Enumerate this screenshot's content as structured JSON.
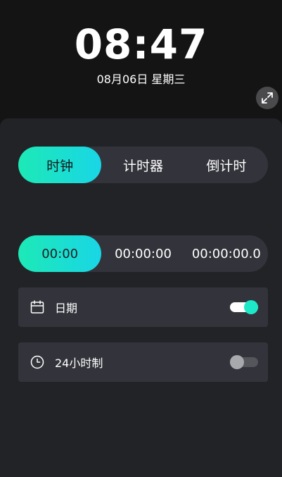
{
  "header": {
    "time": "08:47",
    "date": "08月06日 星期三"
  },
  "mode_tabs": [
    {
      "label": "时钟",
      "active": true
    },
    {
      "label": "计时器",
      "active": false
    },
    {
      "label": "倒计时",
      "active": false
    }
  ],
  "format_tabs": [
    {
      "label": "00:00",
      "active": true
    },
    {
      "label": "00:00:00",
      "active": false
    },
    {
      "label": "00:00:00.0",
      "active": false
    }
  ],
  "settings": {
    "date": {
      "label": "日期",
      "enabled": true,
      "icon": "calendar-icon"
    },
    "h24": {
      "label": "24小时制",
      "enabled": false,
      "icon": "clock-icon"
    }
  },
  "colors": {
    "accent_start": "#1de9b6",
    "accent_end": "#19d6e6",
    "background": "#141414",
    "panel": "#222327",
    "card": "#33343b"
  }
}
